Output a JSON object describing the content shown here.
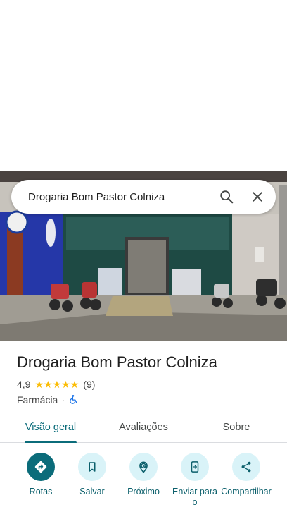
{
  "search": {
    "query": "Drogaria Bom Pastor Colniza"
  },
  "place": {
    "name": "Drogaria Bom Pastor Colniza",
    "rating": "4,9",
    "stars": 5,
    "reviews_count": "(9)",
    "category": "Farmácia",
    "separator": "·",
    "accessibility_icon": "wheelchair-icon"
  },
  "tabs": [
    {
      "label": "Visão geral",
      "active": true
    },
    {
      "label": "Avaliações",
      "active": false
    },
    {
      "label": "Sobre",
      "active": false
    }
  ],
  "actions": [
    {
      "label": "Rotas",
      "icon": "directions-icon"
    },
    {
      "label": "Salvar",
      "icon": "bookmark-icon"
    },
    {
      "label": "Próximo",
      "icon": "nearby-icon"
    },
    {
      "label": "Enviar para o",
      "icon": "send-to-phone-icon"
    },
    {
      "label": "Compartilhar",
      "icon": "share-icon"
    }
  ],
  "colors": {
    "accent": "#0b6c7a",
    "action_bg": "#d9f3f8",
    "star": "#fbbc04"
  }
}
